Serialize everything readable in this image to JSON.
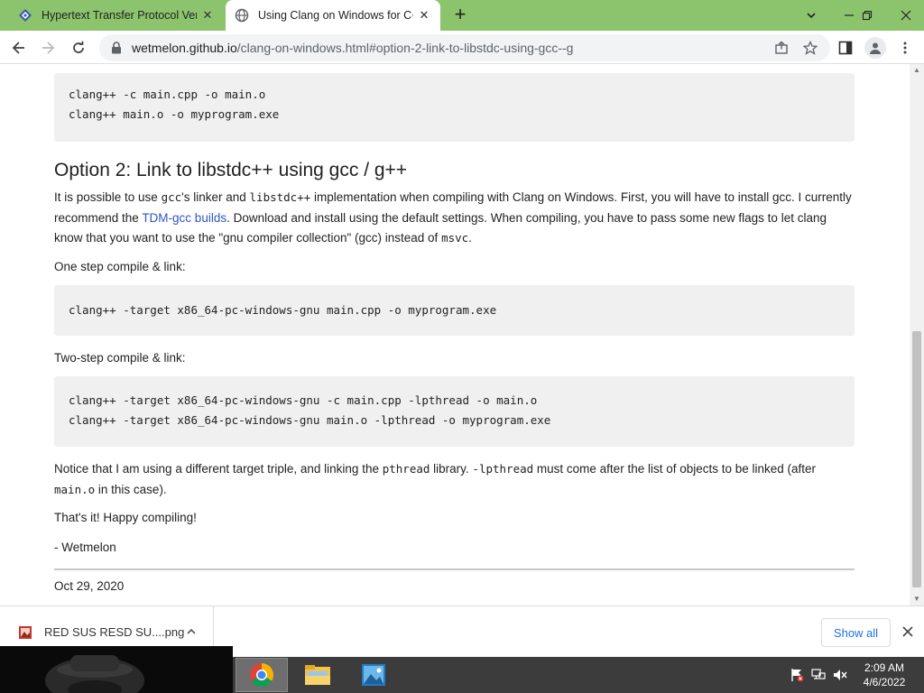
{
  "browser": {
    "tabs": [
      {
        "title": "Hypertext Transfer Protocol Versi",
        "active": false
      },
      {
        "title": "Using Clang on Windows for C++",
        "active": true
      }
    ],
    "new_tab_label": "+",
    "address": {
      "host": "wetmelon.github.io",
      "path": "/clang-on-windows.html#option-2-link-to-libstdc-using-gcc--g"
    }
  },
  "article": {
    "code_top": [
      "clang++ -c main.cpp -o main.o",
      "clang++ main.o -o myprogram.exe"
    ],
    "heading": "Option 2: Link to libstdc++ using gcc / g++",
    "intro": {
      "t1": "It is possible to use ",
      "c1": "gcc",
      "t2": "'s linker and ",
      "c2": "libstdc++",
      "t3": " implementation when compiling with Clang on Windows. First, you will have to install gcc. I currently recommend the ",
      "link": "TDM-gcc builds",
      "t4": ". Download and install using the default settings. When compiling, you have to pass some new flags to let clang know that you want to use the \"gnu compiler collection\" (gcc) instead of ",
      "c3": "msvc",
      "t5": "."
    },
    "one_step_label": "One step compile & link:",
    "code_one_step": [
      "clang++ -target x86_64-pc-windows-gnu main.cpp -o myprogram.exe"
    ],
    "two_step_label": "Two-step compile & link:",
    "code_two_step": [
      "clang++ -target x86_64-pc-windows-gnu -c main.cpp -lpthread -o main.o",
      "clang++ -target x86_64-pc-windows-gnu main.o -lpthread -o myprogram.exe"
    ],
    "notice": {
      "t1": "Notice that I am using a different target triple, and linking the ",
      "c1": "pthread",
      "t2": " library. ",
      "c2": "-lpthread",
      "t3": " must come after the list of objects to be linked (after ",
      "c3": "main.o",
      "t4": " in this case)."
    },
    "closing": "That's it! Happy compiling!",
    "signature": "- Wetmelon",
    "date": "Oct 29, 2020"
  },
  "downloads": {
    "file_name": "RED SUS RESD SU....png",
    "show_all": "Show all"
  },
  "taskbar": {
    "time": "2:09 AM",
    "date": "4/6/2022"
  },
  "colors": {
    "tabstrip": "#8cc36d",
    "link": "#2c56c6",
    "code_bg": "#f0f0f0",
    "taskbar": "#3c3c3c"
  }
}
